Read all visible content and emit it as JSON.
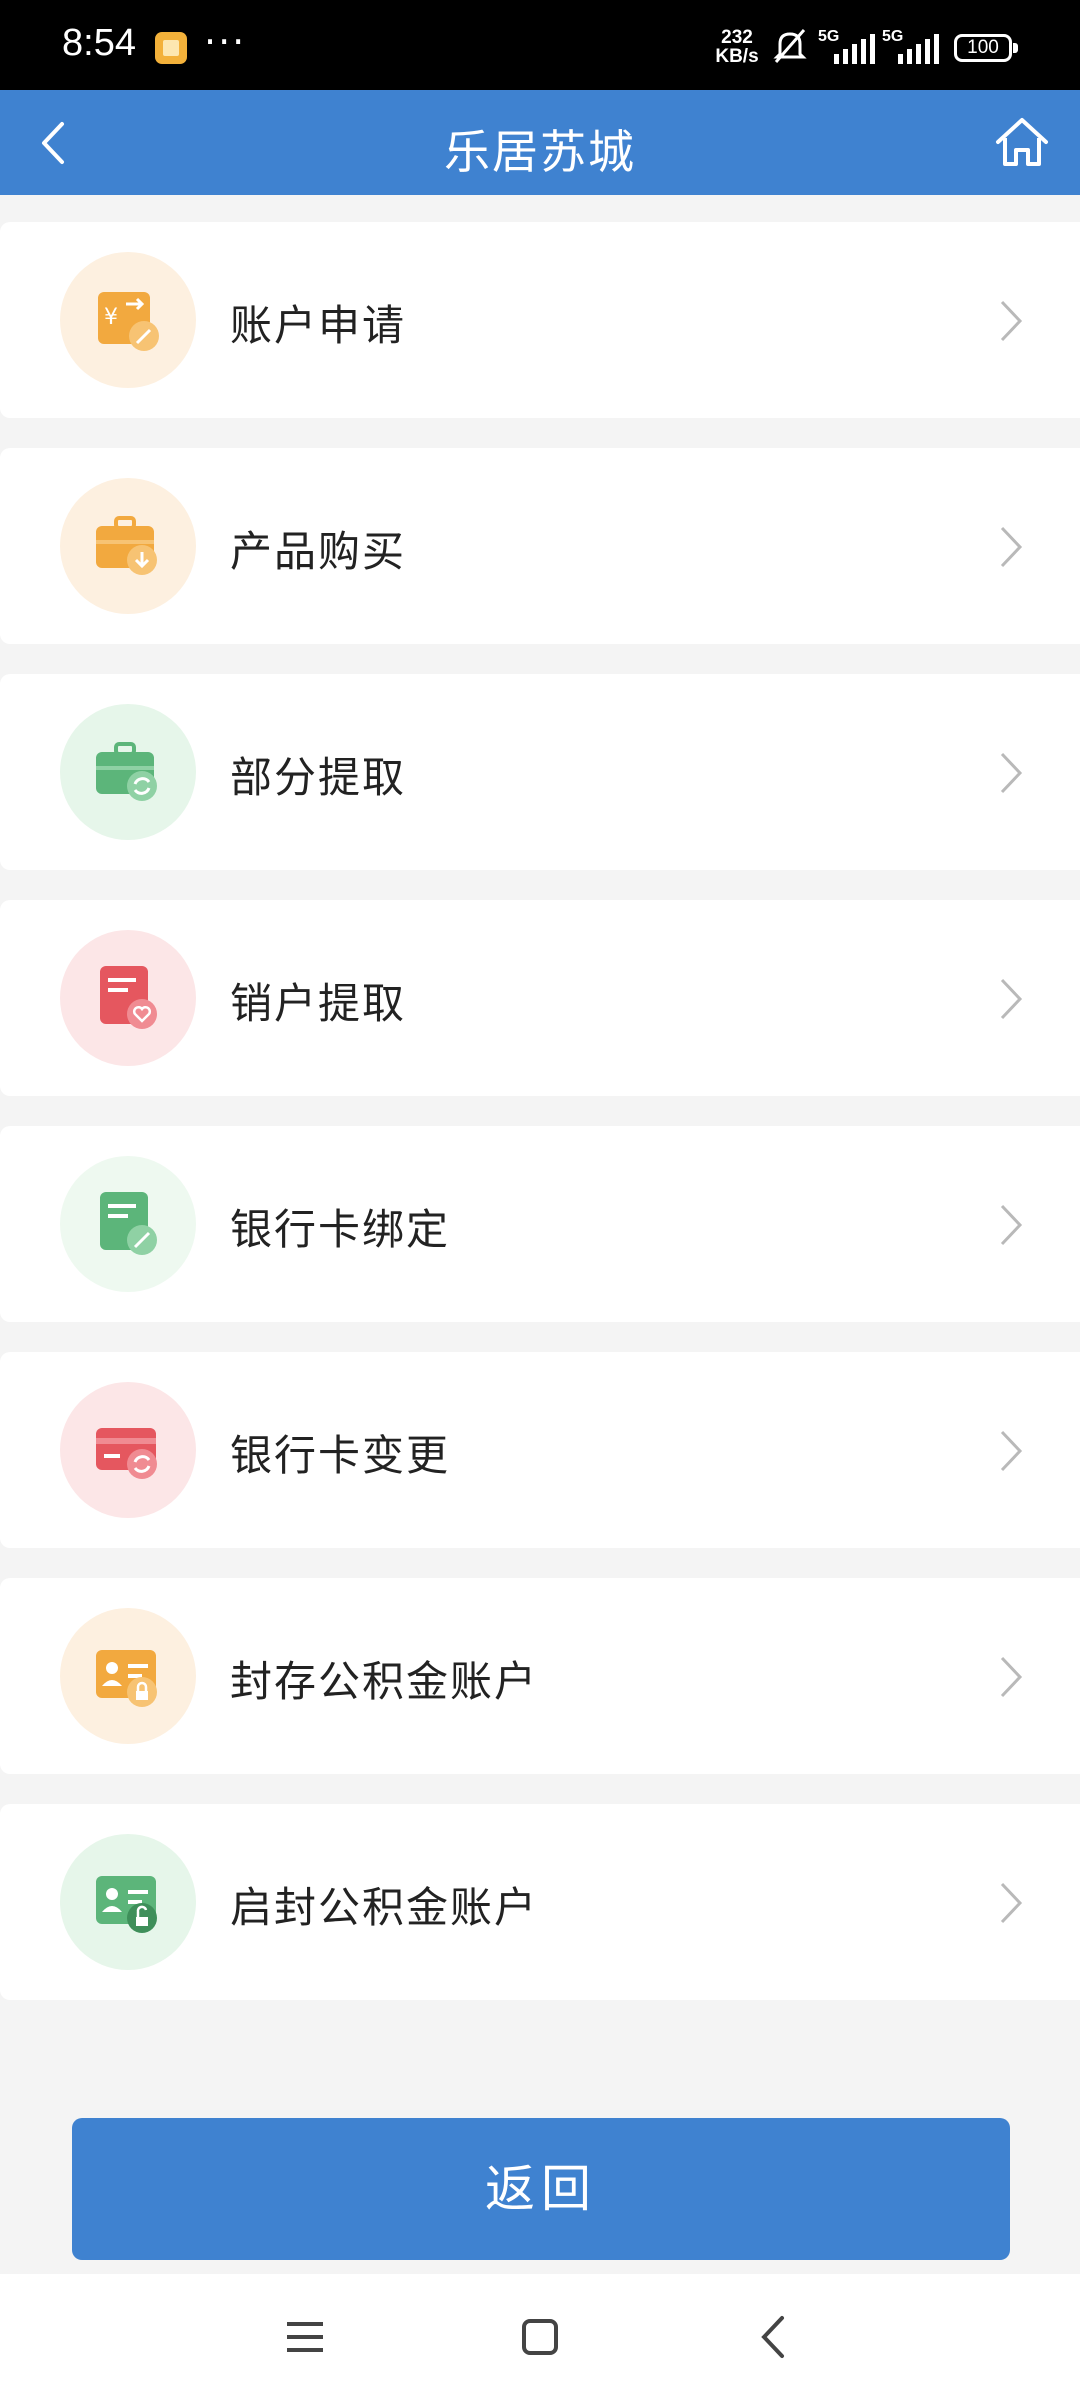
{
  "status_bar": {
    "time": "8:54",
    "more": "···",
    "net_speed_value": "232",
    "net_speed_unit": "KB/s",
    "signal_1_label": "5G",
    "signal_2_label": "5G",
    "battery": "100"
  },
  "header": {
    "title": "乐居苏城",
    "back_icon": "chevron-left-icon",
    "home_icon": "home-icon"
  },
  "menu": {
    "items": [
      {
        "label": "账户申请",
        "icon": "account-apply-icon",
        "accent": "#f0a33c",
        "bg": "#fdf0e0"
      },
      {
        "label": "产品购买",
        "icon": "product-purchase-icon",
        "accent": "#f0a33c",
        "bg": "#fdf0e0"
      },
      {
        "label": "部分提取",
        "icon": "partial-withdraw-icon",
        "accent": "#5cb57a",
        "bg": "#e6f6ea"
      },
      {
        "label": "销户提取",
        "icon": "close-account-withdraw-icon",
        "accent": "#e5575f",
        "bg": "#fce6e7"
      },
      {
        "label": "银行卡绑定",
        "icon": "bind-card-icon",
        "accent": "#5cb57a",
        "bg": "#eef9f0"
      },
      {
        "label": "银行卡变更",
        "icon": "change-card-icon",
        "accent": "#e5575f",
        "bg": "#fce6e7"
      },
      {
        "label": "封存公积金账户",
        "icon": "seal-account-icon",
        "accent": "#f0a33c",
        "bg": "#fdf0e0"
      },
      {
        "label": "启封公积金账户",
        "icon": "unseal-account-icon",
        "accent": "#5cb57a",
        "bg": "#e6f6ea"
      }
    ]
  },
  "footer": {
    "return_label": "返回"
  },
  "nav": {
    "menu_icon": "menu-icon",
    "home_icon": "square-home-icon",
    "back_icon": "back-arrow-icon"
  }
}
